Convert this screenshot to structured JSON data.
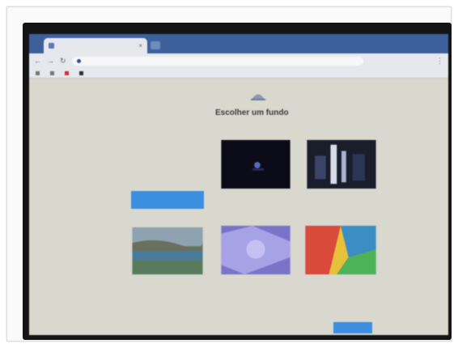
{
  "browser": {
    "tab_title": "",
    "url": "",
    "bookmarks": [
      {
        "label": "",
        "icon": "grid-icon"
      },
      {
        "label": "",
        "icon": "page-icon"
      },
      {
        "label": "",
        "icon": "red-bookmark-icon"
      },
      {
        "label": "",
        "icon": "dark-bookmark-icon"
      }
    ]
  },
  "page": {
    "title": "Escolher um fundo",
    "import_button": "",
    "next_button": ""
  },
  "wallpapers": [
    {
      "caption": "",
      "style": "night"
    },
    {
      "caption": "",
      "style": "city"
    },
    {
      "caption": "",
      "style": "lake"
    },
    {
      "caption": "",
      "style": "purple"
    },
    {
      "caption": "",
      "style": "colorful"
    }
  ],
  "colors": {
    "accent": "#3c8ee0",
    "tabstrip": "#3d5f9a",
    "screen_bg": "#d9d8cf"
  }
}
